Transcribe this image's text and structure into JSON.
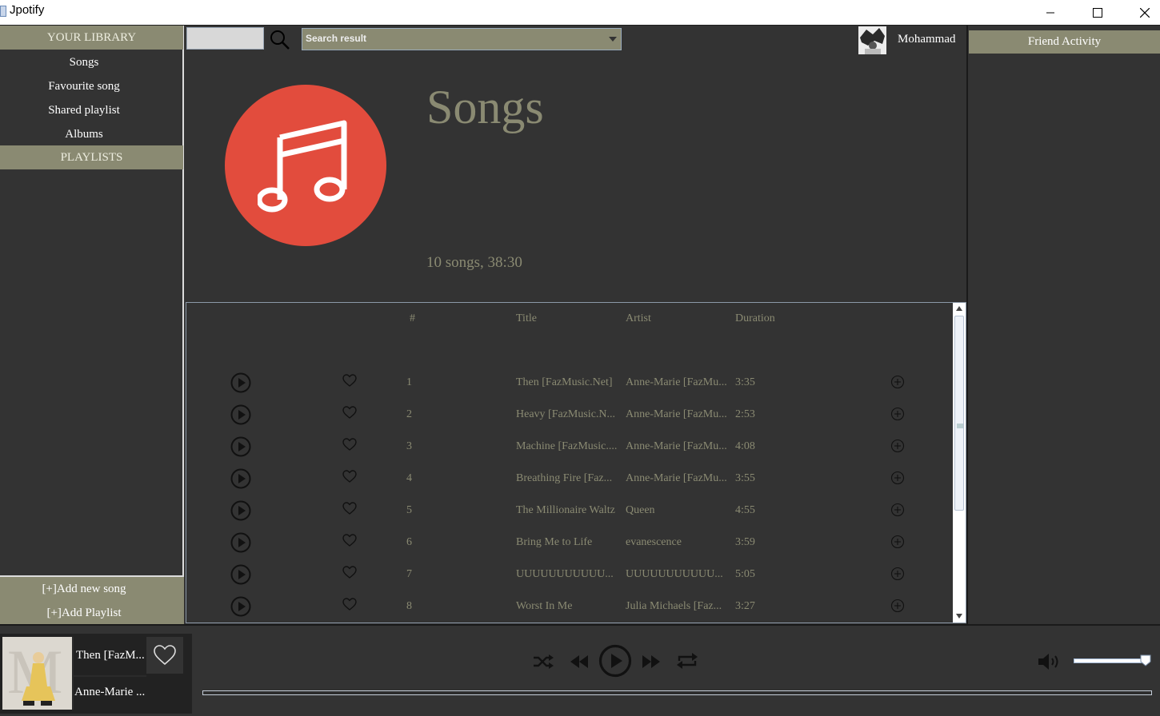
{
  "window": {
    "title": "Jpotify"
  },
  "sidebar": {
    "library_header": "YOUR LIBRARY",
    "items": [
      "Songs",
      "Favourite song",
      "Shared playlist",
      "Albums"
    ],
    "playlists_header": "PLAYLISTS",
    "add_song": "[+]Add new song",
    "add_playlist": "[+]Add Playlist"
  },
  "search": {
    "query": "",
    "result_placeholder": "Search result"
  },
  "user": {
    "name": "Mohammad"
  },
  "page": {
    "title": "Songs",
    "meta": "10 songs, 38:30"
  },
  "table": {
    "headers": {
      "index": "#",
      "title": "Title",
      "artist": "Artist",
      "duration": "Duration"
    },
    "rows": [
      {
        "index": "1",
        "title": "Then [FazMusic.Net]",
        "artist": "Anne-Marie [FazMu...",
        "duration": "3:35"
      },
      {
        "index": "2",
        "title": "Heavy [FazMusic.N...",
        "artist": "Anne-Marie [FazMu...",
        "duration": "2:53"
      },
      {
        "index": "3",
        "title": "Machine [FazMusic....",
        "artist": "Anne-Marie [FazMu...",
        "duration": "4:08"
      },
      {
        "index": "4",
        "title": "Breathing Fire [Faz...",
        "artist": "Anne-Marie [FazMu...",
        "duration": "3:55"
      },
      {
        "index": "5",
        "title": "The Millionaire Waltz",
        "artist": "Queen",
        "duration": "4:55"
      },
      {
        "index": "6",
        "title": "Bring Me to Life",
        "artist": "evanescence",
        "duration": "3:59"
      },
      {
        "index": "7",
        "title": "UUUUUUUUUUU...",
        "artist": "UUUUUUUUUUU...",
        "duration": "5:05"
      },
      {
        "index": "8",
        "title": "Worst In Me",
        "artist": "Julia Michaels [Faz...",
        "duration": "3:27"
      }
    ]
  },
  "friends": {
    "header": "Friend Activity"
  },
  "player": {
    "now_title": "Then [FazM...",
    "now_artist": "Anne-Marie ...",
    "volume_level": 0.95,
    "progress": 0.0
  },
  "colors": {
    "accent": "#8a8a72",
    "background": "#333333",
    "cover": "#e24c3d"
  }
}
